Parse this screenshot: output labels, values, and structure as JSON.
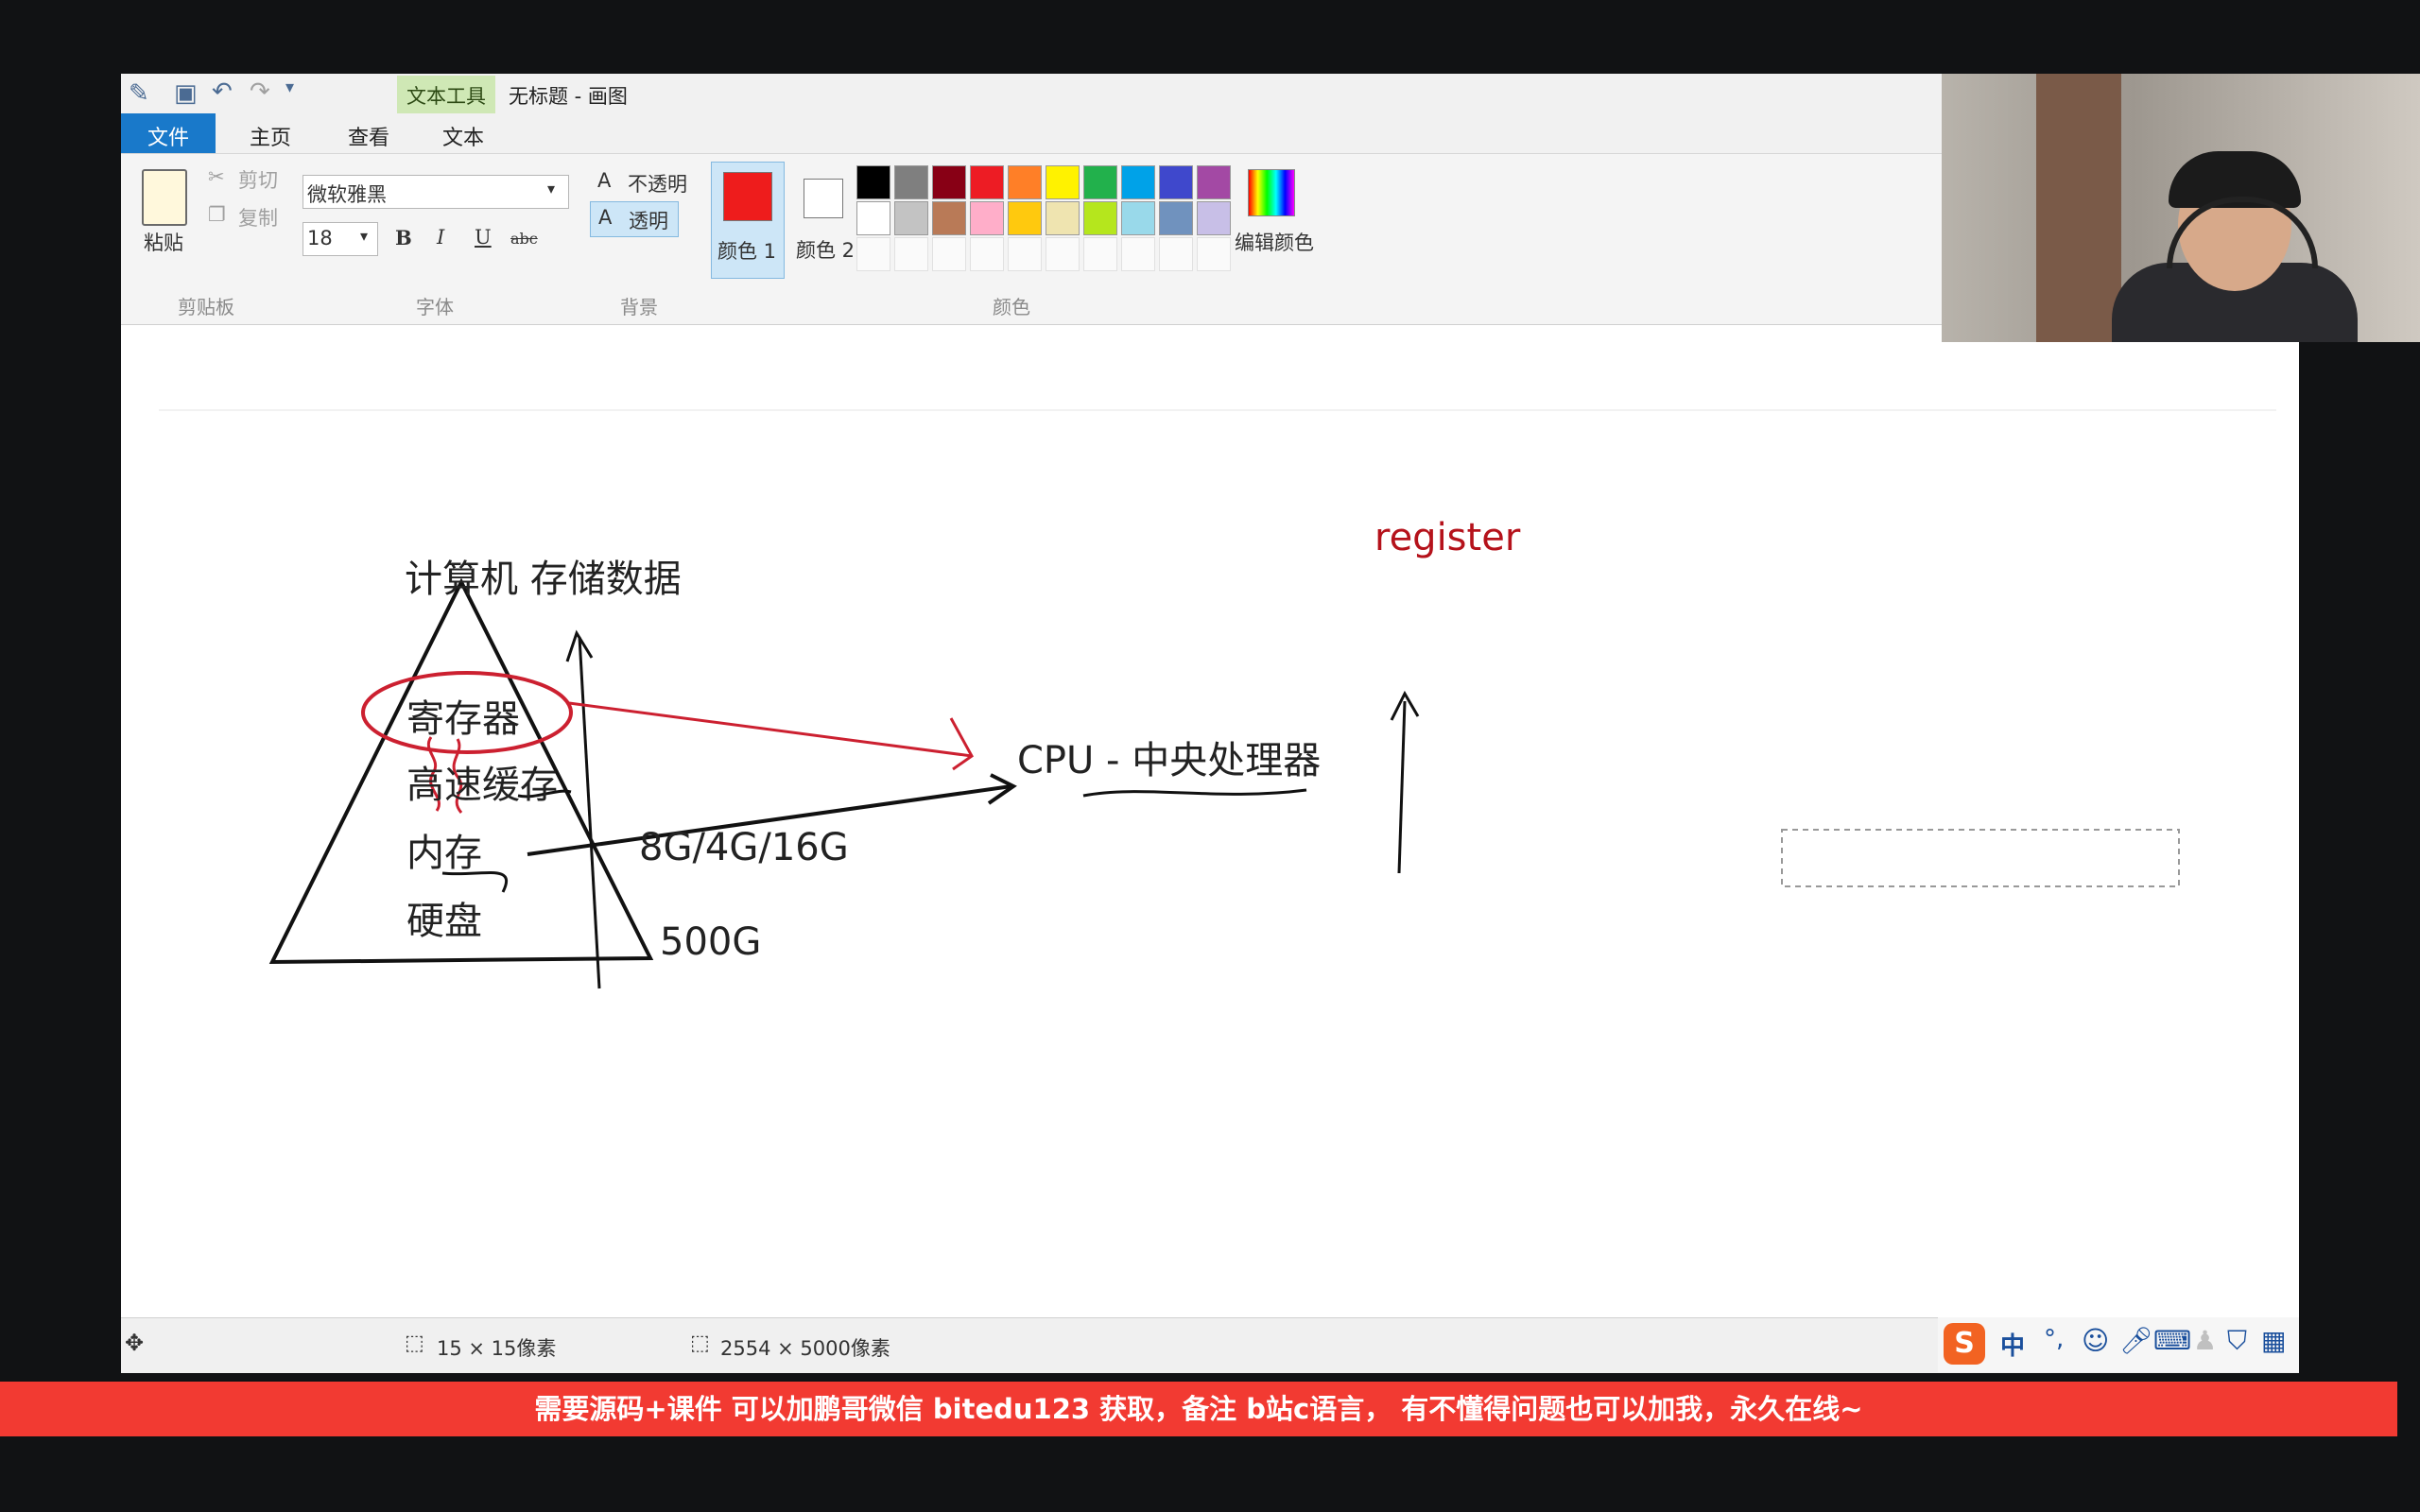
{
  "app": {
    "title": "无标题 - 画图",
    "context_tab": "文本工具"
  },
  "tabs": [
    {
      "label": "文件",
      "active": true
    },
    {
      "label": "主页"
    },
    {
      "label": "查看"
    },
    {
      "label": "文本"
    }
  ],
  "clipboard": {
    "paste": "粘贴",
    "cut": "剪切",
    "copy": "复制",
    "group": "剪贴板"
  },
  "font": {
    "family": "微软雅黑",
    "size": "18",
    "bold": "B",
    "italic": "I",
    "underline": "U",
    "strike": "abc",
    "group": "字体"
  },
  "background": {
    "opaque": "不透明",
    "transparent": "透明",
    "group": "背景"
  },
  "colors": {
    "color1_label": "颜色 1",
    "color2_label": "颜色 2",
    "edit_label": "编辑颜色",
    "group": "颜色",
    "color1": "#ee1c1c",
    "color2": "#ffffff",
    "palette_row1": [
      "#000000",
      "#7f7f7f",
      "#880015",
      "#ed1c24",
      "#ff7f27",
      "#fff200",
      "#22b14c",
      "#00a2e8",
      "#3f48cc",
      "#a349a4"
    ],
    "palette_row2": [
      "#ffffff",
      "#c3c3c3",
      "#b97a57",
      "#ffaec9",
      "#ffc90e",
      "#efe4b0",
      "#b5e61d",
      "#99d9ea",
      "#7092be",
      "#c8bfe7"
    ]
  },
  "canvas": {
    "title": "计算机 存储数据",
    "levels": [
      "寄存器",
      "高速缓存",
      "内存",
      "硬盘"
    ],
    "cpu": "CPU - 中央处理器",
    "mem_size": "8G/4G/16G",
    "disk_size": "500G",
    "register": "register"
  },
  "status": {
    "selection": "15 × 15像素",
    "canvas_size": "2554 × 5000像素",
    "ime": "中"
  },
  "banner": "需要源码+课件 可以加鹏哥微信 bitedu123 获取，备注 b站c语言， 有不懂得问题也可以加我，永久在线~"
}
